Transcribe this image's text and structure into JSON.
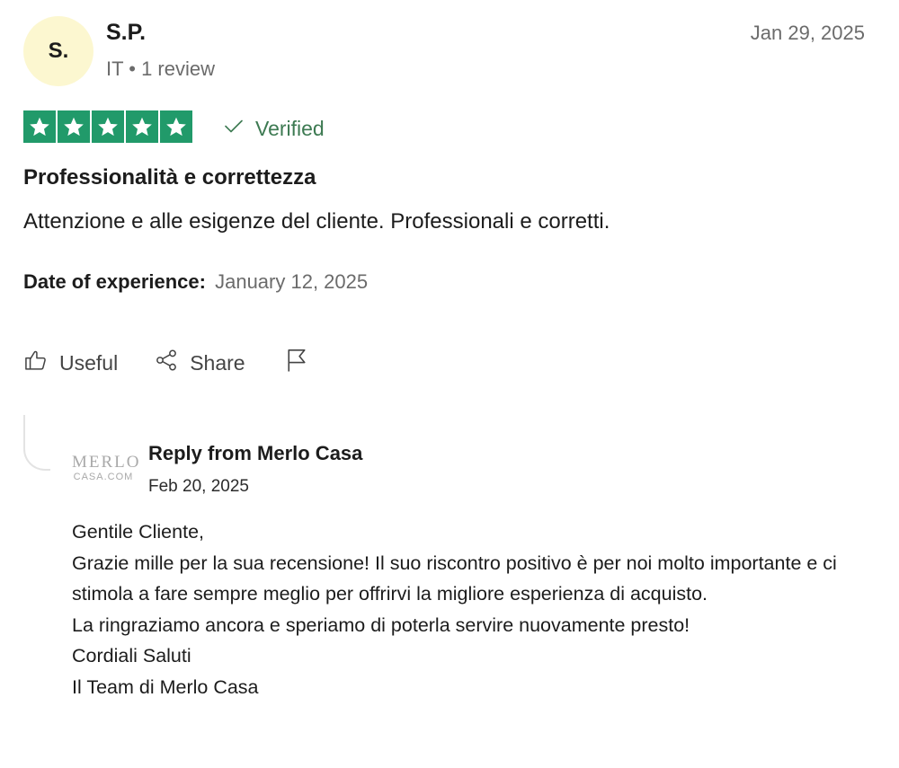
{
  "reviewer": {
    "initials": "S.",
    "name": "S.P.",
    "meta": "IT • 1 review",
    "date": "Jan 29, 2025"
  },
  "rating": {
    "stars": 5,
    "max": 5,
    "color": "#219a6a"
  },
  "verified_label": "Verified",
  "review": {
    "title": "Professionalità e correttezza",
    "body": "Attenzione e alle esigenze del cliente. Professionali e corretti.",
    "experience_label": "Date of experience:",
    "experience_date": "January 12, 2025"
  },
  "actions": {
    "useful_label": "Useful",
    "share_label": "Share"
  },
  "reply": {
    "logo_line1": "MERLO",
    "logo_line2": "CASA.COM",
    "title": "Reply from Merlo Casa",
    "date": "Feb 20, 2025",
    "lines": [
      "Gentile Cliente,",
      "Grazie mille per la sua recensione! Il suo riscontro positivo è per noi molto importante e ci stimola a fare sempre meglio per offrirvi la migliore esperienza di acquisto.",
      "La ringraziamo ancora e speriamo di poterla servire nuovamente presto!",
      "Cordiali Saluti",
      "Il Team di Merlo Casa"
    ]
  }
}
